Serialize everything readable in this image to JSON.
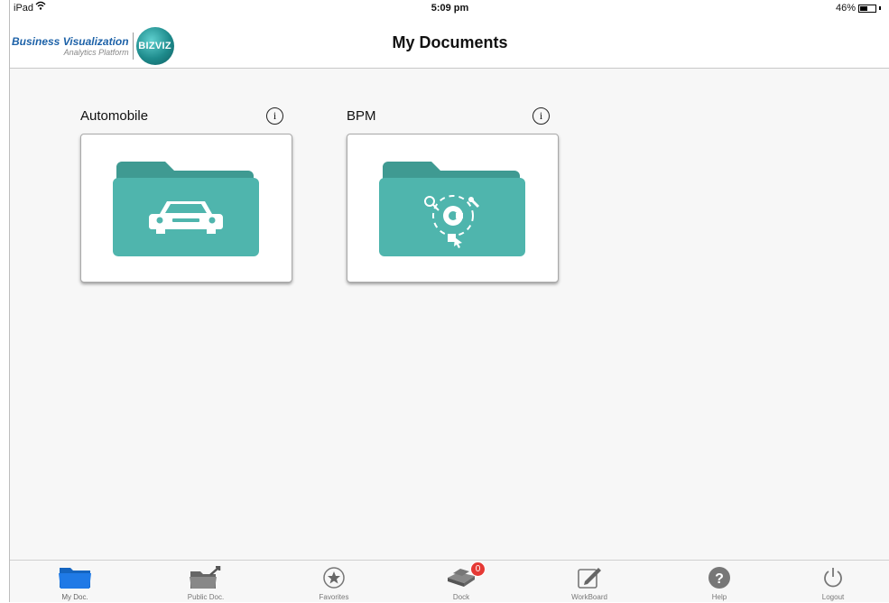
{
  "status_bar": {
    "device": "iPad",
    "time": "5:09 pm",
    "battery": "46%"
  },
  "header": {
    "logo_title": "Business Visualization",
    "logo_subtitle": "Analytics Platform",
    "logo_badge": "BIZVIZ",
    "title": "My Documents"
  },
  "folders": [
    {
      "name": "Automobile",
      "icon": "car-icon"
    },
    {
      "name": "BPM",
      "icon": "process-gear-icon"
    }
  ],
  "tabs": [
    {
      "label": "My Doc.",
      "icon": "folder-icon",
      "active": true
    },
    {
      "label": "Public Doc.",
      "icon": "public-folder-icon"
    },
    {
      "label": "Favorites",
      "icon": "star-icon"
    },
    {
      "label": "Dock",
      "icon": "dock-icon",
      "badge": "0"
    },
    {
      "label": "WorkBoard",
      "icon": "edit-icon"
    },
    {
      "label": "Help",
      "icon": "help-icon"
    },
    {
      "label": "Logout",
      "icon": "power-icon"
    }
  ],
  "colors": {
    "folder_teal": "#4fb5ad",
    "active_tab": "#1f7ae6",
    "badge_red": "#e53935"
  }
}
